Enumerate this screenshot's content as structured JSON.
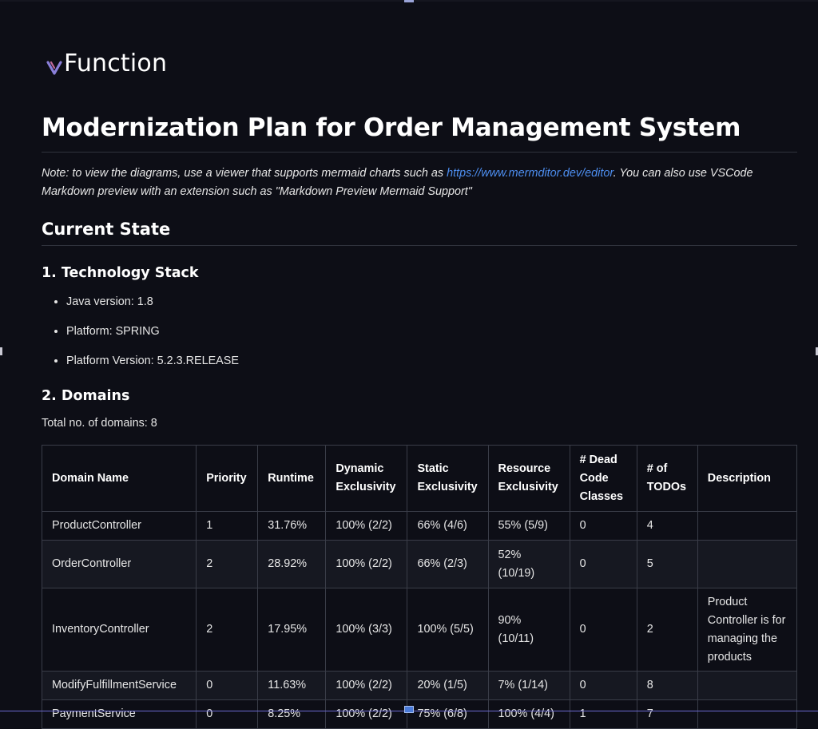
{
  "logo": {
    "text": "Function",
    "mark": "v-logo-icon"
  },
  "title": "Modernization Plan for Order Management System",
  "note": {
    "before": "Note: to view the diagrams, use a viewer that supports mermaid charts such as ",
    "link": "https://www.mermditor.dev/editor",
    "after": ". You can also use VSCode Markdown preview with an extension such as \"Markdown Preview Mermaid Support\""
  },
  "current_state": "Current State",
  "tech_stack": {
    "heading": "1. Technology Stack",
    "items": [
      "Java version: 1.8",
      "Platform: SPRING",
      "Platform Version: 5.2.3.RELEASE"
    ]
  },
  "domains": {
    "heading": "2. Domains",
    "total": "Total no. of domains: 8",
    "headers": [
      "Domain Name",
      "Priority",
      "Runtime",
      "Dynamic Exclusivity",
      "Static Exclusivity",
      "Resource Exclusivity",
      "# Dead Code Classes",
      "# of TODOs",
      "Description"
    ],
    "rows": [
      [
        "ProductController",
        "1",
        "31.76%",
        "100% (2/2)",
        "66% (4/6)",
        "55% (5/9)",
        "0",
        "4",
        ""
      ],
      [
        "OrderController",
        "2",
        "28.92%",
        "100% (2/2)",
        "66% (2/3)",
        "52% (10/19)",
        "0",
        "5",
        ""
      ],
      [
        "InventoryController",
        "2",
        "17.95%",
        "100% (3/3)",
        "100% (5/5)",
        "90% (10/11)",
        "0",
        "2",
        "Product Controller is for managing the products"
      ],
      [
        "ModifyFulfillmentService",
        "0",
        "11.63%",
        "100% (2/2)",
        "20% (1/5)",
        "7% (1/14)",
        "0",
        "8",
        ""
      ],
      [
        "PaymentService",
        "0",
        "8.25%",
        "100% (2/2)",
        "75% (6/8)",
        "100% (4/4)",
        "1",
        "7",
        ""
      ]
    ]
  },
  "colors": {
    "background": "#0d0e16",
    "link": "#4d8ef0",
    "logo_accent": "#8a7fd9"
  }
}
